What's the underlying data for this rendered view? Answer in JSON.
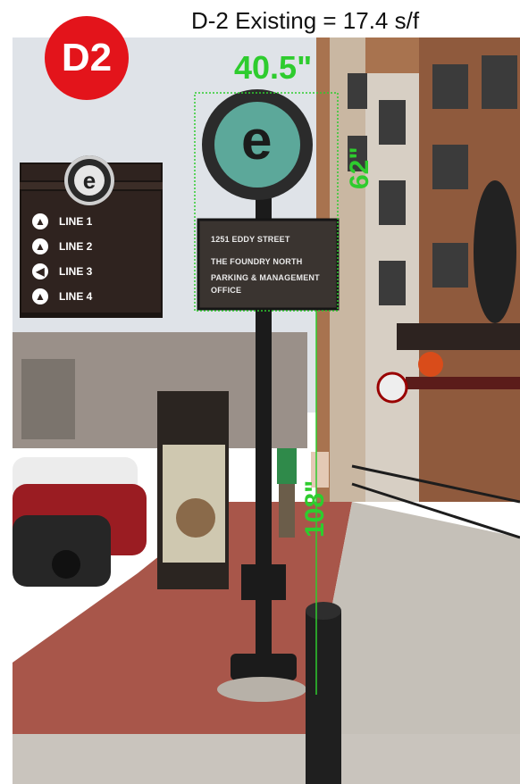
{
  "header": {
    "title": "D-2 Existing = 17.4 s/f"
  },
  "badge": {
    "label": "D2",
    "color": "#e3141b"
  },
  "dimensions": {
    "width_label": "40.5\"",
    "panel_height_label": "62\"",
    "pole_height_label": "108\"",
    "color": "#2ecc2e"
  },
  "legend": {
    "logo": "e",
    "items": [
      {
        "label": "LINE 1",
        "icon": "arrow-up-icon"
      },
      {
        "label": "LINE 2",
        "icon": "arrow-up-icon"
      },
      {
        "label": "LINE 3",
        "icon": "arrow-left-icon"
      },
      {
        "label": "LINE 4",
        "icon": "arrow-up-icon"
      }
    ]
  },
  "sign": {
    "logo": "e",
    "lines": [
      "1251 EDDY STREET",
      "THE FOUNDRY NORTH",
      "PARKING & MANAGEMENT",
      "OFFICE"
    ]
  }
}
